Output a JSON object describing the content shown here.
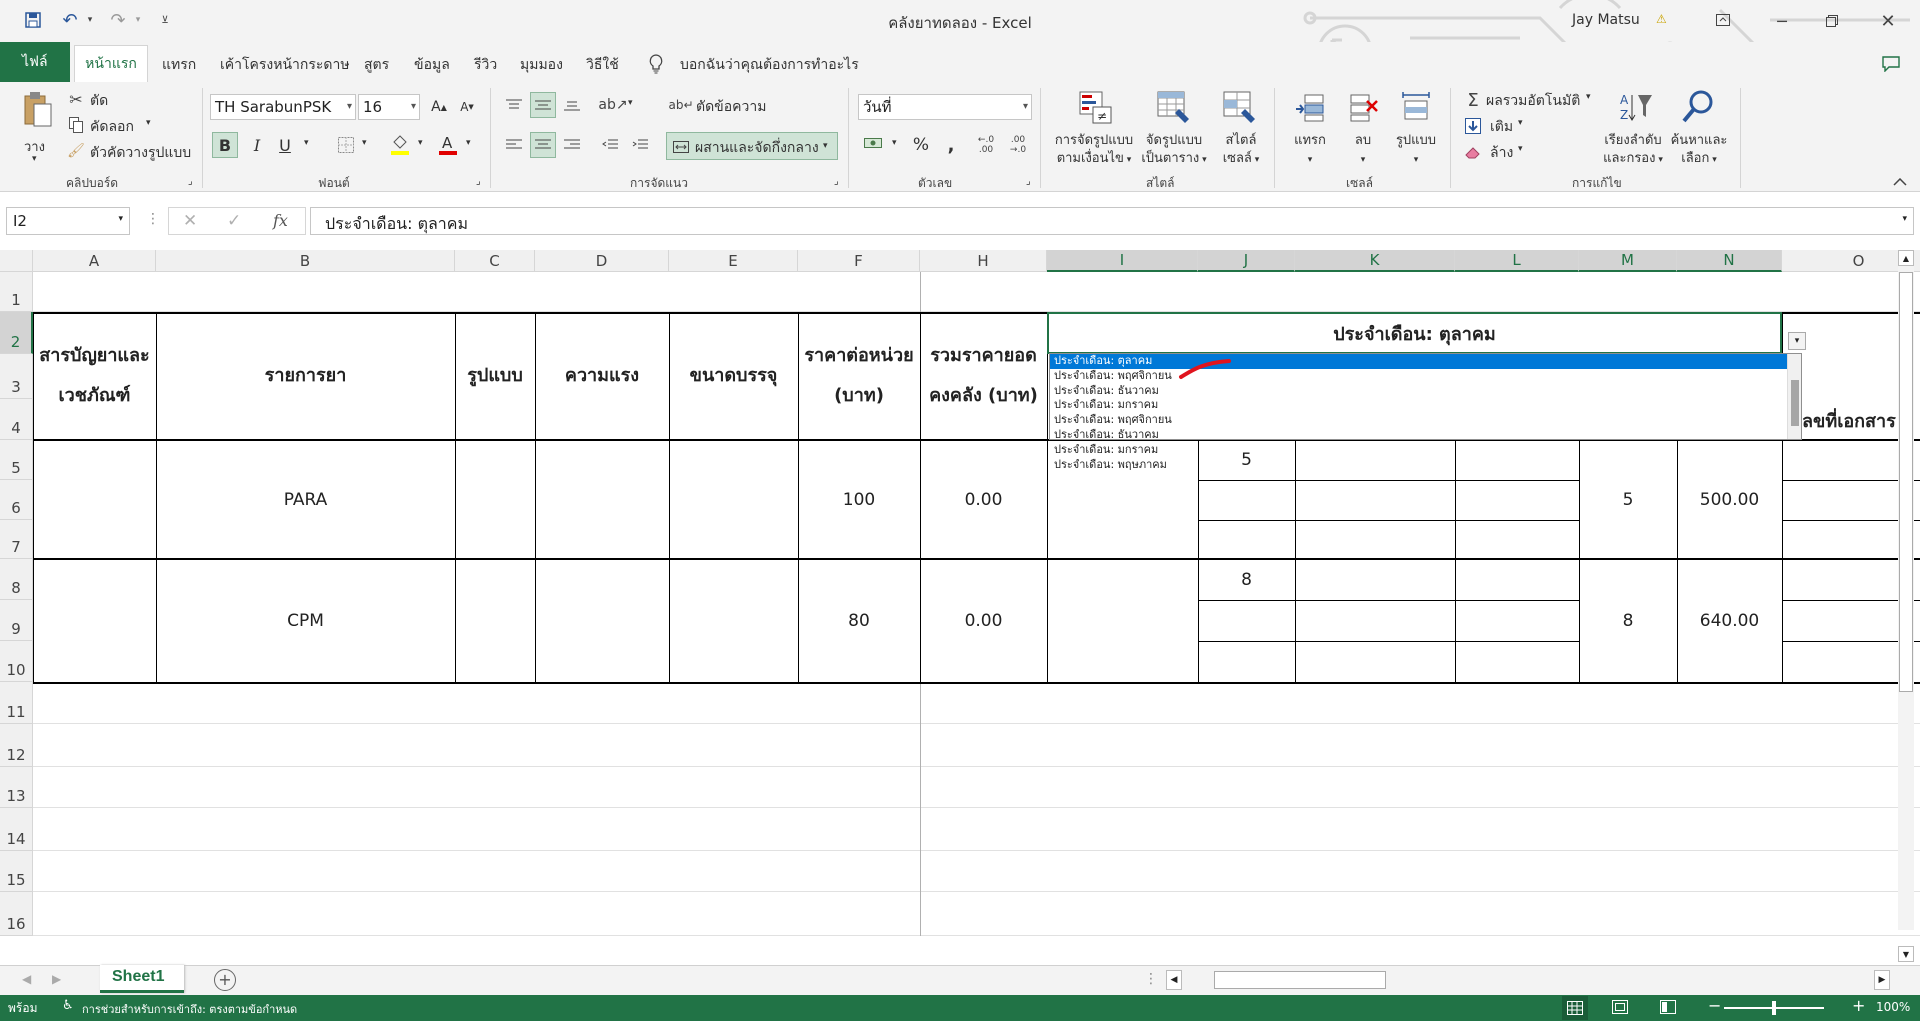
{
  "titlebar": {
    "title": "คลังยาทดลอง  -  Excel",
    "user": "Jay Matsu",
    "user_badge": "⚠"
  },
  "tabs": [
    {
      "label": "ไฟล์"
    },
    {
      "label": "หน้าแรก"
    },
    {
      "label": "แทรก"
    },
    {
      "label": "เค้าโครงหน้ากระดาษ"
    },
    {
      "label": "สูตร"
    },
    {
      "label": "ข้อมูล"
    },
    {
      "label": "รีวิว"
    },
    {
      "label": "มุมมอง"
    },
    {
      "label": "วิธีใช้"
    }
  ],
  "tell_me": "บอกฉันว่าคุณต้องการทำอะไร",
  "ribbon": {
    "clipboard": {
      "paste": "วาง",
      "cut": "ตัด",
      "copy": "คัดลอก",
      "format_painter": "ตัวคัดวางรูปแบบ",
      "label": "คลิปบอร์ด"
    },
    "font": {
      "name": "TH SarabunPSK",
      "size": "16",
      "label": "ฟอนต์"
    },
    "alignment": {
      "wrap": "ตัดข้อความ",
      "merge": "ผสานและจัดกึ่งกลาง",
      "label": "การจัดแนว"
    },
    "number": {
      "format": "วันที่",
      "label": "ตัวเลข"
    },
    "styles": {
      "cond_line1": "การจัดรูปแบบ",
      "cond_line2": "ตามเงื่อนไข",
      "table_line1": "จัดรูปแบบ",
      "table_line2": "เป็นตาราง",
      "cell_line1": "สไตล์",
      "cell_line2": "เซลล์",
      "label": "สไตล์"
    },
    "cells": {
      "insert": "แทรก",
      "delete": "ลบ",
      "format": "รูปแบบ",
      "label": "เซลล์"
    },
    "editing": {
      "autosum": "ผลรวมอัตโนมัติ",
      "fill": "เติม",
      "clear": "ล้าง",
      "sort_line1": "เรียงลำดับ",
      "sort_line2": "และกรอง",
      "find_line1": "ค้นหาและ",
      "find_line2": "เลือก",
      "label": "การแก้ไข"
    }
  },
  "formula_bar": {
    "name_box": "I2",
    "content": "ประจำเดือน: ตุลาคม",
    "fx": "fx"
  },
  "columns": [
    "A",
    "B",
    "C",
    "D",
    "E",
    "F",
    "H",
    "I",
    "J",
    "K",
    "L",
    "M",
    "N",
    "O"
  ],
  "rows": [
    "1",
    "2",
    "3",
    "4",
    "5",
    "6",
    "7",
    "8",
    "9",
    "10",
    "11",
    "12",
    "13",
    "14",
    "15",
    "16"
  ],
  "table": {
    "headers": {
      "A": "สารบัญยาและเวชภัณฑ์",
      "B": "รายการยา",
      "C": "รูปแบบ",
      "D": "ความแรง",
      "E": "ขนาดบรรจุ",
      "F": "ราคาต่อหน่วย (บาท)",
      "H": "รวมราคายอดคงคลัง (บาท)",
      "month": "ประจำเดือน: ตุลาคม",
      "O_partial": "ลขที่เอกสาร"
    },
    "items": [
      {
        "name": "PARA",
        "price": "100",
        "total": "0.00",
        "J": "5",
        "M": "5",
        "N": "500.00"
      },
      {
        "name": "CPM",
        "price": "80",
        "total": "0.00",
        "J": "8",
        "M": "8",
        "N": "640.00"
      }
    ]
  },
  "dropdown": {
    "options": [
      "ประจำเดือน: ตุลาคม",
      "ประจำเดือน: พฤศจิกายน",
      "ประจำเดือน: ธันวาคม",
      "ประจำเดือน: มกราคม",
      "ประจำเดือน: พฤศจิกายน",
      "ประจำเดือน: ธันวาคม",
      "ประจำเดือน: มกราคม",
      "ประจำเดือน: พฤษภาคม"
    ],
    "selected_index": 0
  },
  "sheet_tab": "Sheet1",
  "status": {
    "ready": "พร้อม",
    "accessibility": "การช่วยสำหรับการเข้าถึง: ตรงตามข้อกำหนด",
    "zoom": "100%"
  },
  "colors": {
    "excel_green": "#217346",
    "selection_blue": "#0078d7"
  }
}
